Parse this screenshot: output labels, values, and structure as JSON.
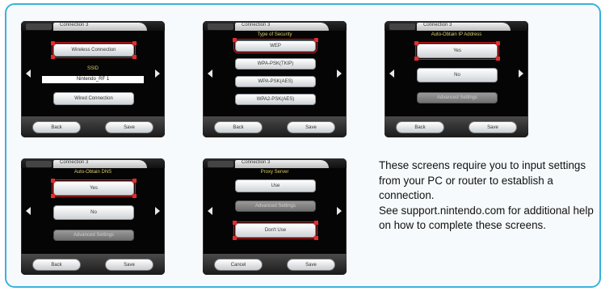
{
  "screens": [
    {
      "tab_title": "Connection 3",
      "buttons": [
        "Wireless Connection",
        "Wired Connection"
      ],
      "ssid_label": "SSID",
      "ssid_value": "Nintendo_RF 1",
      "back": "Back",
      "save": "Save"
    },
    {
      "tab_title": "Connection 3",
      "heading": "Type of Security",
      "options": [
        "WEP",
        "WPA-PSK(TKIP)",
        "WPA-PSK(AES)",
        "WPA2-PSK(AES)"
      ],
      "back": "Back",
      "save": "Save"
    },
    {
      "tab_title": "Connection 3",
      "heading": "Auto-Obtain IP Address",
      "options": [
        "Yes",
        "No"
      ],
      "advanced": "Advanced Settings",
      "back": "Back",
      "save": "Save"
    },
    {
      "tab_title": "Connection 3",
      "heading": "Auto-Obtain DNS",
      "options": [
        "Yes",
        "No"
      ],
      "advanced": "Advanced Settings",
      "back": "Back",
      "save": "Save"
    },
    {
      "tab_title": "Connection 3",
      "heading": "Proxy Server",
      "options": [
        "Use",
        "Don't Use"
      ],
      "advanced": "Advanced Settings",
      "back": "Cancel",
      "save": "Save"
    }
  ],
  "description": {
    "line1": "These screens require you to input settings from your PC or router to establish a connection.",
    "line2": "See support.nintendo.com for additional help on how to complete these screens."
  }
}
